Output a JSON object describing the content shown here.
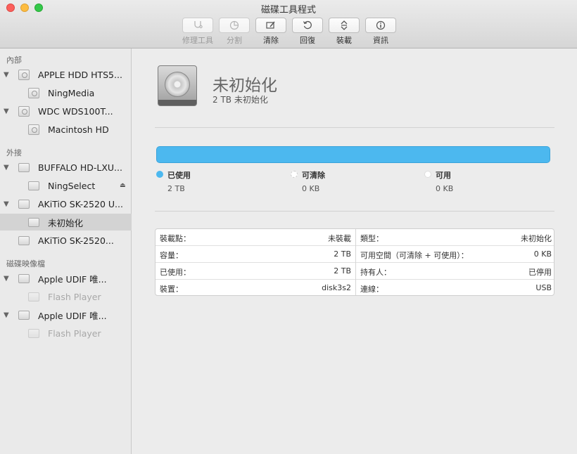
{
  "window": {
    "title": "磁碟工具程式"
  },
  "toolbar": {
    "first_aid": {
      "label": "修理工具",
      "icon": "stethoscope-icon"
    },
    "partition": {
      "label": "分割",
      "icon": "pie-icon"
    },
    "erase": {
      "label": "清除",
      "icon": "erase-icon"
    },
    "restore": {
      "label": "回復",
      "icon": "restore-icon"
    },
    "mount": {
      "label": "裝載",
      "icon": "mount-icon"
    },
    "info": {
      "label": "資訊",
      "icon": "info-icon"
    }
  },
  "sidebar": {
    "sections": [
      {
        "label": "內部"
      },
      {
        "label": "外接"
      },
      {
        "label": "磁碟映像檔"
      }
    ],
    "items": [
      {
        "label": "APPLE HDD HTS5..."
      },
      {
        "label": "NingMedia"
      },
      {
        "label": "WDC WDS100T..."
      },
      {
        "label": "Macintosh HD"
      },
      {
        "label": "BUFFALO HD-LXU..."
      },
      {
        "label": "NingSelect"
      },
      {
        "label": "AKiTiO SK-2520 U..."
      },
      {
        "label": "未初始化"
      },
      {
        "label": "AKiTiO SK-2520..."
      },
      {
        "label": "Apple UDIF 唯..."
      },
      {
        "label": "Flash Player"
      },
      {
        "label": "Apple UDIF 唯..."
      },
      {
        "label": "Flash Player"
      }
    ]
  },
  "volume": {
    "title": "未初始化",
    "subtitle": "2 TB 未初始化",
    "used_fraction": 1.0
  },
  "legend": [
    {
      "name": "已使用",
      "value": "2 TB",
      "color": "#4cb8ef"
    },
    {
      "name": "可清除",
      "value": "0 KB",
      "color": "#ffffff"
    },
    {
      "name": "可用",
      "value": "0 KB",
      "color": "#ffffff"
    }
  ],
  "info": {
    "left": [
      {
        "key": "裝載點：",
        "value": "未裝載"
      },
      {
        "key": "容量：",
        "value": "2 TB"
      },
      {
        "key": "已使用：",
        "value": "2 TB"
      },
      {
        "key": "裝置：",
        "value": "disk3s2"
      }
    ],
    "right": [
      {
        "key": "類型：",
        "value": "未初始化"
      },
      {
        "key": "可用空間（可清除 + 可使用）：",
        "value": "0 KB"
      },
      {
        "key": "持有人：",
        "value": "已停用"
      },
      {
        "key": "連線：",
        "value": "USB"
      }
    ]
  }
}
